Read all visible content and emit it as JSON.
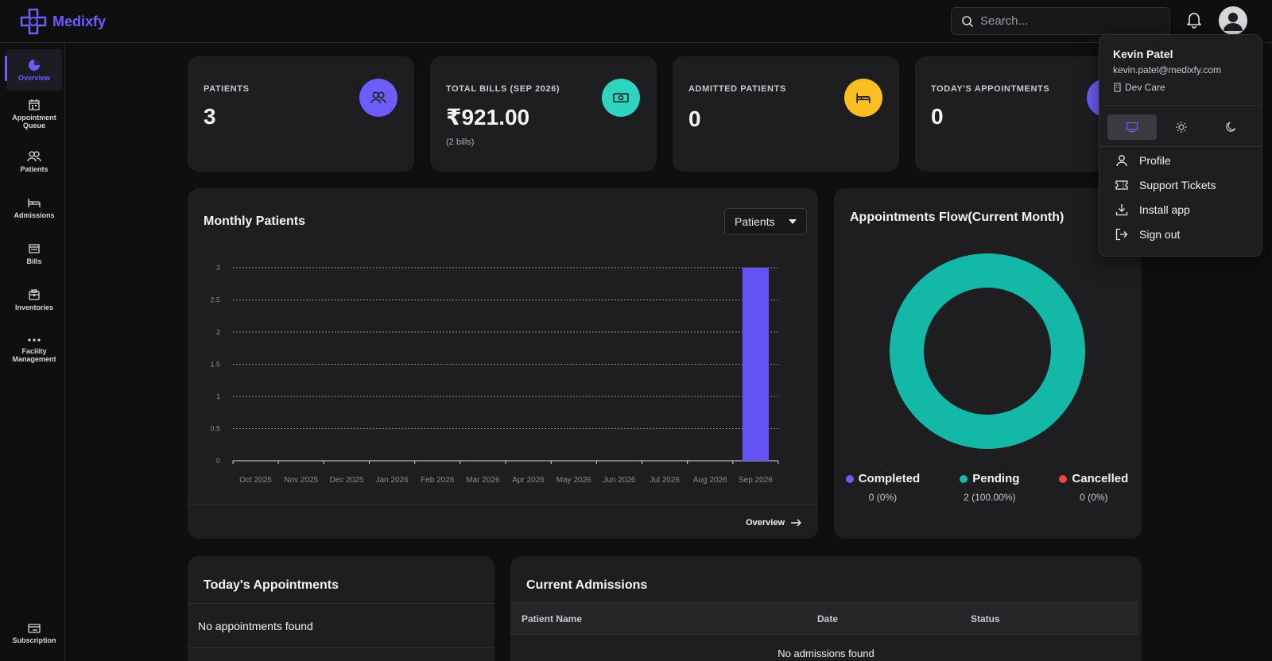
{
  "brand": {
    "name": "Medixfy",
    "color": "#6d5dfc"
  },
  "search": {
    "placeholder": "Search..."
  },
  "sidebar": {
    "items": [
      {
        "label": "Overview",
        "icon": "pie-chart-icon",
        "active": true
      },
      {
        "label": "Appointment Queue",
        "icon": "calendar-icon"
      },
      {
        "label": "Patients",
        "icon": "users-icon"
      },
      {
        "label": "Admissions",
        "icon": "bed-icon"
      },
      {
        "label": "Bills",
        "icon": "bill-icon"
      },
      {
        "label": "Inventories",
        "icon": "box-icon"
      },
      {
        "label": "Facility Management",
        "icon": "more-icon"
      },
      {
        "label": "Subscription",
        "icon": "card-icon"
      }
    ]
  },
  "stats": [
    {
      "label": "PATIENTS",
      "value": "3",
      "sub": "",
      "icon": "users-icon",
      "color": "#6d5dfc"
    },
    {
      "label": "TOTAL BILLS (SEP 2026)",
      "value": "₹921.00",
      "sub": "(2 bills)",
      "icon": "cash-icon",
      "color": "#2dd4bf"
    },
    {
      "label": "ADMITTED PATIENTS",
      "value": "0",
      "sub": "",
      "icon": "bed-icon",
      "color": "#fbbf24"
    },
    {
      "label": "TODAY'S APPOINTMENTS",
      "value": "0",
      "sub": "",
      "icon": "calendar-icon",
      "color": "#6d5dfc"
    }
  ],
  "monthly": {
    "title": "Monthly Patients",
    "select_value": "Patients",
    "link": "Overview"
  },
  "chart_data": [
    {
      "type": "bar",
      "title": "Monthly Patients",
      "categories": [
        "Oct 2025",
        "Nov 2025",
        "Dec 2025",
        "Jan 2026",
        "Feb 2026",
        "Mar 2026",
        "Apr 2026",
        "May 2026",
        "Jun 2026",
        "Jul 2026",
        "Aug 2026",
        "Sep 2026"
      ],
      "values": [
        0,
        0,
        0,
        0,
        0,
        0,
        0,
        0,
        0,
        0,
        0,
        3
      ],
      "yticks": [
        "0",
        "0.5",
        "1",
        "1.5",
        "2",
        "2.5",
        "3"
      ],
      "ylim": [
        0,
        3
      ],
      "grid": true,
      "color": "#6353f5"
    },
    {
      "type": "pie",
      "title": "Appointments Flow(Current Month)",
      "slices": [
        {
          "name": "Completed",
          "value": 0,
          "display": "0 (0%)",
          "color": "#6d5dfc"
        },
        {
          "name": "Pending",
          "value": 2,
          "display": "2 (100.00%)",
          "color": "#14b8a6"
        },
        {
          "name": "Cancelled",
          "value": 0,
          "display": "0 (0%)",
          "color": "#ef4444"
        }
      ]
    }
  ],
  "appointments": {
    "title": "Today's Appointments",
    "empty": "No appointments found"
  },
  "admissions": {
    "title": "Current Admissions",
    "columns": [
      "Patient Name",
      "Date",
      "Status"
    ],
    "empty": "No admissions found"
  },
  "user_menu": {
    "name": "Kevin Patel",
    "email": "kevin.patel@medixfy.com",
    "org": "Dev Care",
    "items": [
      {
        "label": "Profile",
        "icon": "user-icon"
      },
      {
        "label": "Support Tickets",
        "icon": "ticket-icon"
      },
      {
        "label": "Install app",
        "icon": "download-icon"
      },
      {
        "label": "Sign out",
        "icon": "sign-out-icon"
      }
    ]
  }
}
